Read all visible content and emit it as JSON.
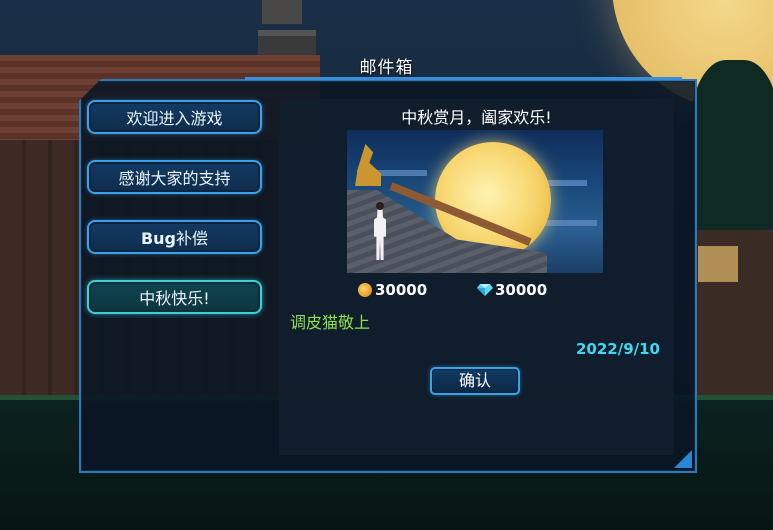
{
  "mailbox": {
    "title": "邮件箱",
    "mails": [
      {
        "label": "欢迎进入游戏",
        "active": false
      },
      {
        "label": "感谢大家的支持",
        "active": false
      },
      {
        "label_bold": "Bug",
        "label_rest": "补偿",
        "active": false
      },
      {
        "label": "中秋快乐!",
        "active": true
      }
    ]
  },
  "mail_detail": {
    "title": "中秋赏月，阖家欢乐!",
    "image": "mid-autumn-moon-rooftop-illustration",
    "rewards": [
      {
        "icon": "gold-coin-icon",
        "amount": "30000"
      },
      {
        "icon": "diamond-icon",
        "amount": "30000"
      }
    ],
    "sender": "调皮猫敬上",
    "date": "2022/9/10",
    "confirm_label": "确认"
  },
  "colors": {
    "panel_border": "#2e77b8",
    "button_border": "#3aa2e6",
    "active_button_border": "#3ed0d8",
    "sender_text": "#8ce04a",
    "date_text": "#3ed8f0"
  }
}
